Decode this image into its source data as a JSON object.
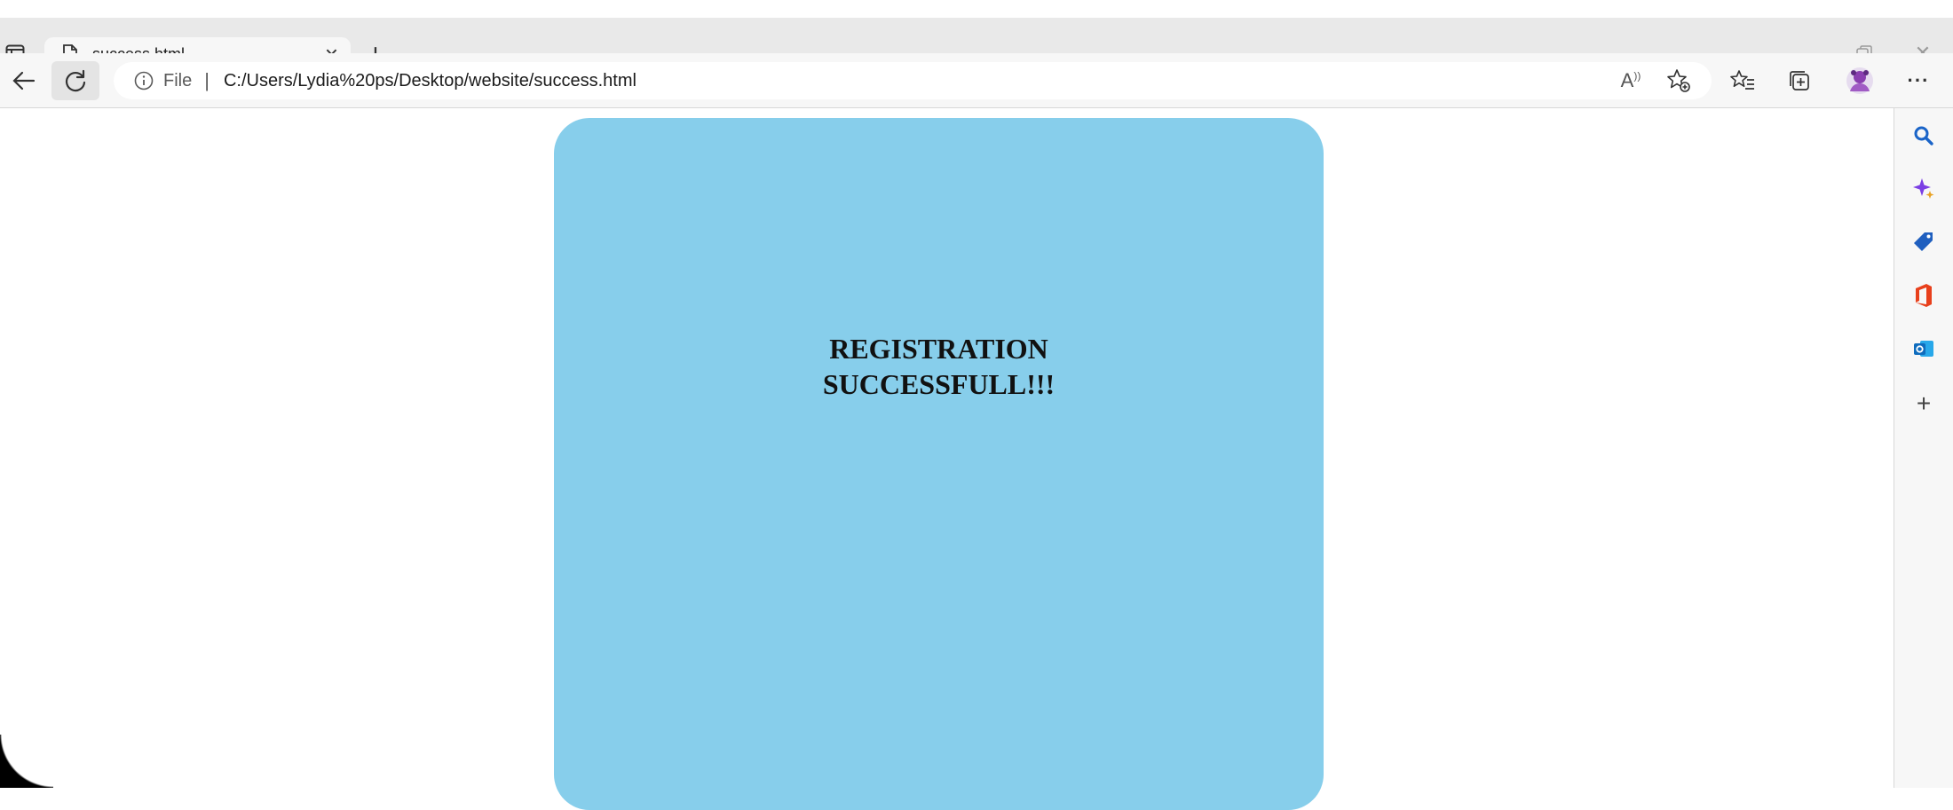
{
  "tab": {
    "title": "success.html"
  },
  "address": {
    "scheme": "File",
    "separator": "|",
    "url": "C:/Users/Lydia%20ps/Desktop/website/success.html"
  },
  "page": {
    "heading_line1": "REGISTRATION",
    "heading_line2": "SUCCESSFULL!!!",
    "card_color": "#87ceeb"
  },
  "sidebar": {
    "items": [
      "search-icon",
      "copilot-icon",
      "shopping-icon",
      "office-icon",
      "outlook-icon",
      "add-icon"
    ]
  }
}
